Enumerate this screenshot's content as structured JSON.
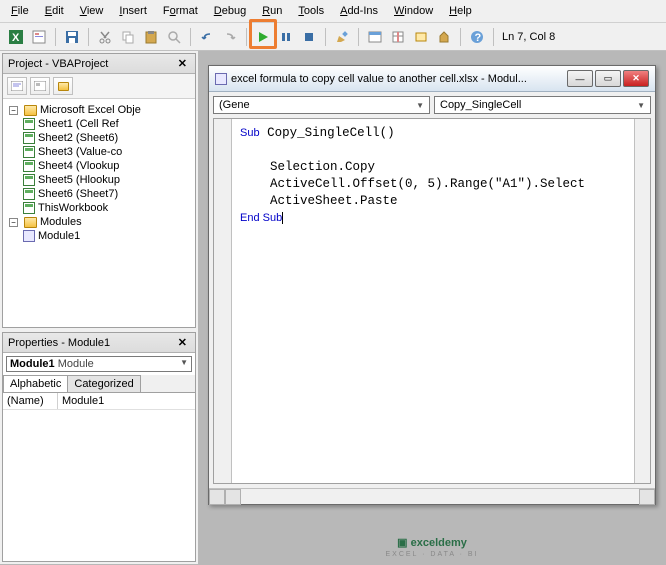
{
  "menu": [
    "File",
    "Edit",
    "View",
    "Insert",
    "Format",
    "Debug",
    "Run",
    "Tools",
    "Add-Ins",
    "Window",
    "Help"
  ],
  "cursor_pos": "Ln 7, Col 8",
  "project_panel": {
    "title": "Project - VBAProject",
    "root": "Microsoft Excel Obje",
    "sheets": [
      "Sheet1 (Cell Ref",
      "Sheet2 (Sheet6)",
      "Sheet3 (Value-co",
      "Sheet4 (Vlookup",
      "Sheet5 (Hlookup",
      "Sheet6 (Sheet7)",
      "ThisWorkbook"
    ],
    "modules_label": "Modules",
    "module": "Module1"
  },
  "properties_panel": {
    "title": "Properties - Module1",
    "object": "Module1",
    "object_type": "Module",
    "tabs": [
      "Alphabetic",
      "Categorized"
    ],
    "row_name_label": "(Name)",
    "row_name_value": "Module1"
  },
  "code_window": {
    "title": "excel formula to copy cell value to another cell.xlsx - Modul...",
    "combo_left": "(Gene",
    "combo_right": "Copy_SingleCell",
    "code_lines": [
      {
        "t": "Sub",
        "k": true
      },
      {
        "t": " Copy_SingleCell()"
      },
      {
        "br": true
      },
      {
        "br": true
      },
      {
        "t": "    Selection.Copy"
      },
      {
        "br": true
      },
      {
        "t": "    ActiveCell.Offset(0, 5).Range(\"A1\").Select"
      },
      {
        "br": true
      },
      {
        "t": "    ActiveSheet.Paste"
      },
      {
        "br": true
      },
      {
        "t": "End Sub",
        "k": true
      }
    ]
  },
  "brand": {
    "name": "exceldemy",
    "tagline": "EXCEL · DATA · BI"
  }
}
